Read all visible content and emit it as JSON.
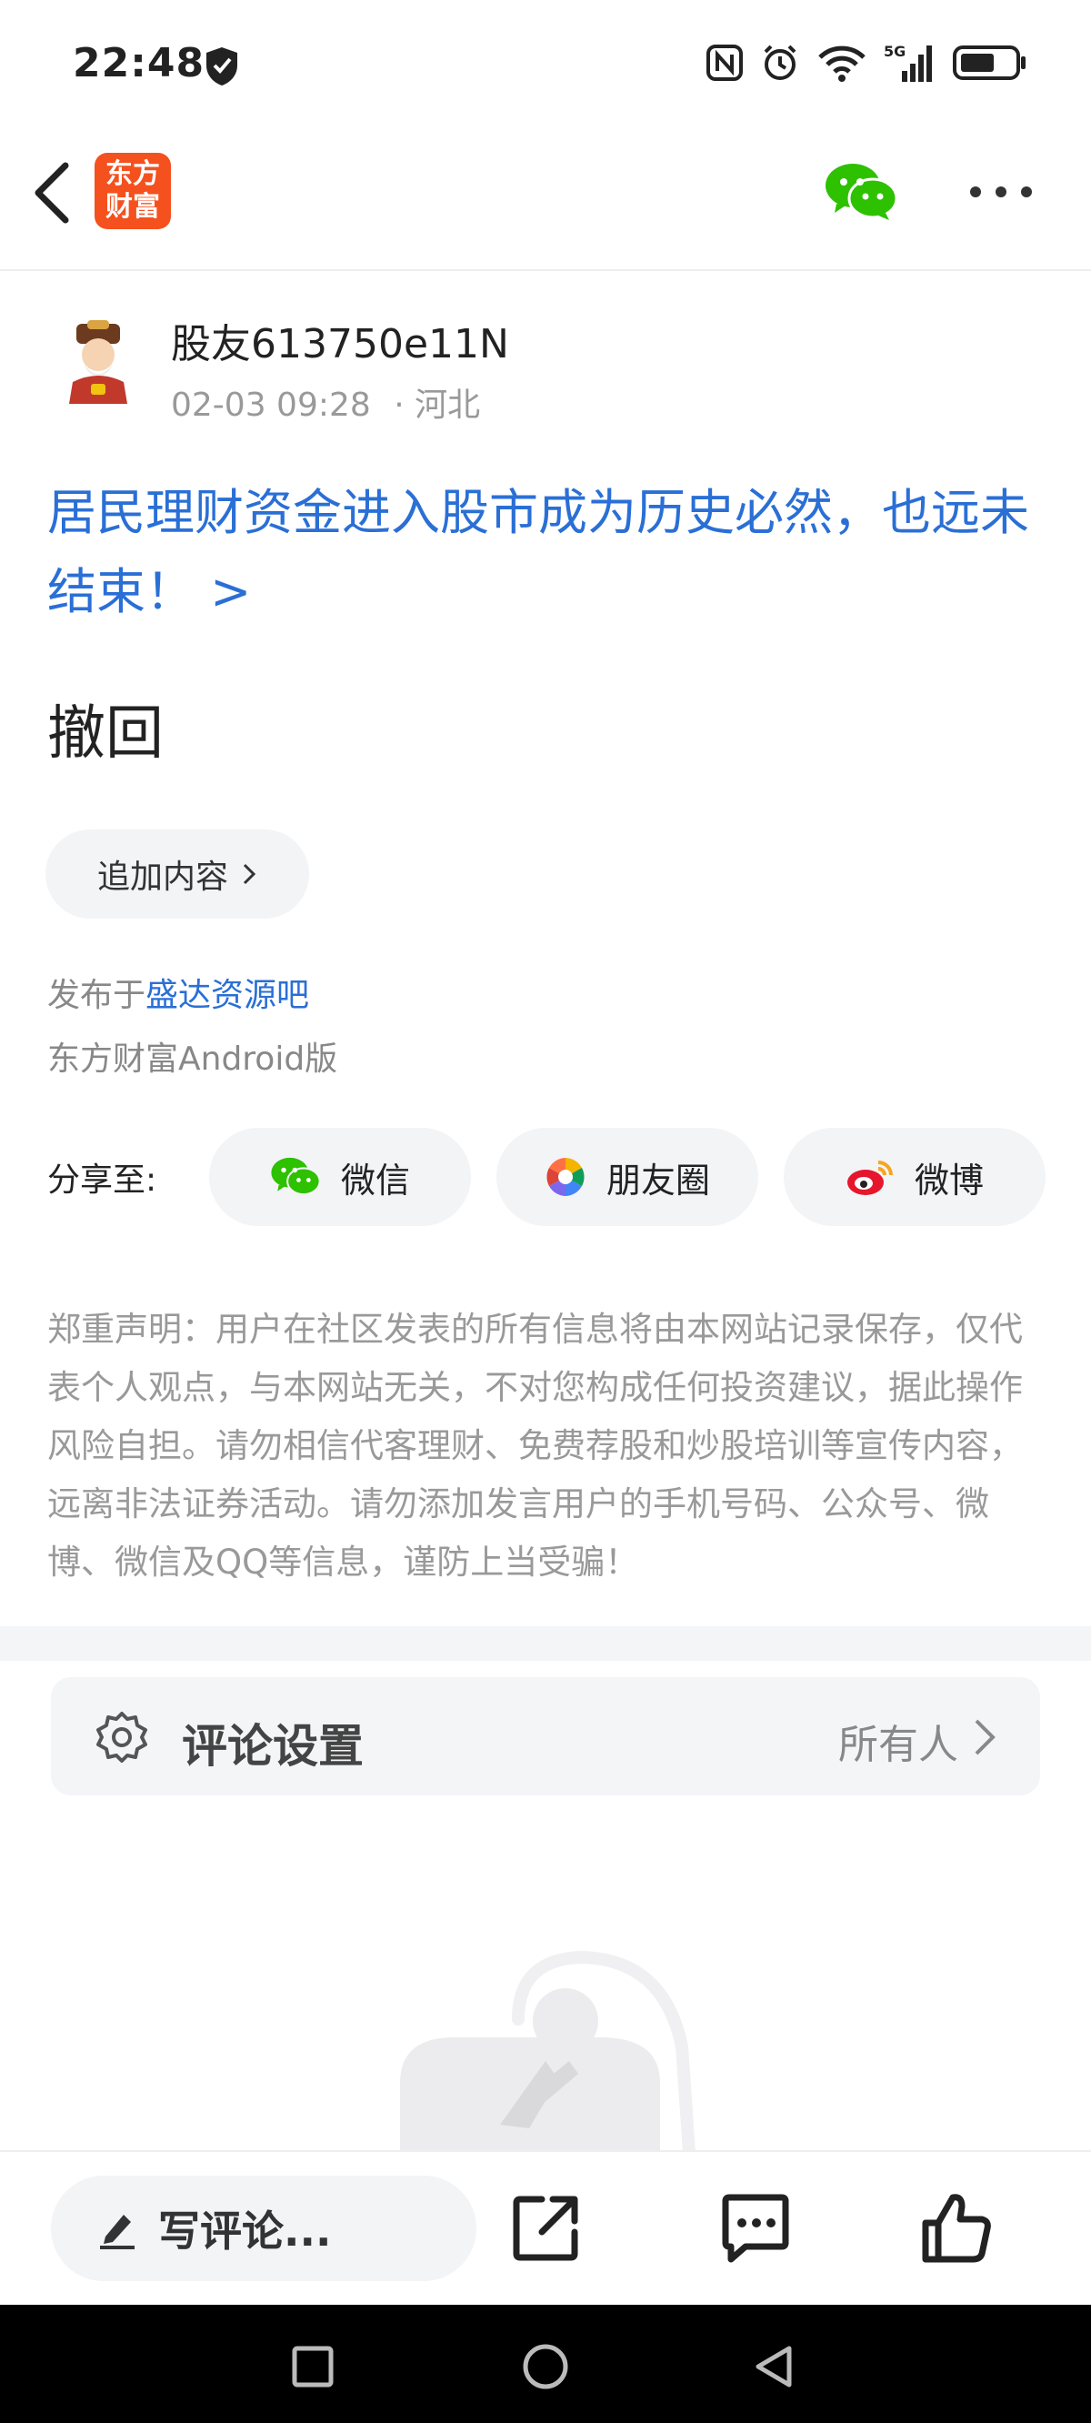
{
  "status_bar": {
    "time": "22:48",
    "network": "5G"
  },
  "nav": {
    "logo_line1": "东方",
    "logo_line2": "财富"
  },
  "post": {
    "author": "股友613750e11N",
    "date": "02-03 09:28",
    "location": "· 河北",
    "title": "居民理财资金进入股市成为历史必然，也远未结束！ >",
    "body": "撤回",
    "append_label": "追加内容",
    "published_prefix": "发布于",
    "forum_name": "盛达资源吧",
    "client": "东方财富Android版"
  },
  "share": {
    "label": "分享至:",
    "wechat": "微信",
    "moments": "朋友圈",
    "weibo": "微博"
  },
  "disclaimer": "郑重声明：用户在社区发表的所有信息将由本网站记录保存，仅代表个人观点，与本网站无关，不对您构成任何投资建议，据此操作风险自担。请勿相信代客理财、免费荐股和炒股培训等宣传内容，远离非法证券活动。请勿添加发言用户的手机号码、公众号、微博、微信及QQ等信息，谨防上当受骗！",
  "comment_settings": {
    "label": "评论设置",
    "value": "所有人"
  },
  "bottom_bar": {
    "write_placeholder": "写评论..."
  },
  "colors": {
    "accent": "#2a6fd6",
    "brand": "#f4511e",
    "wechat": "#2dc100"
  }
}
